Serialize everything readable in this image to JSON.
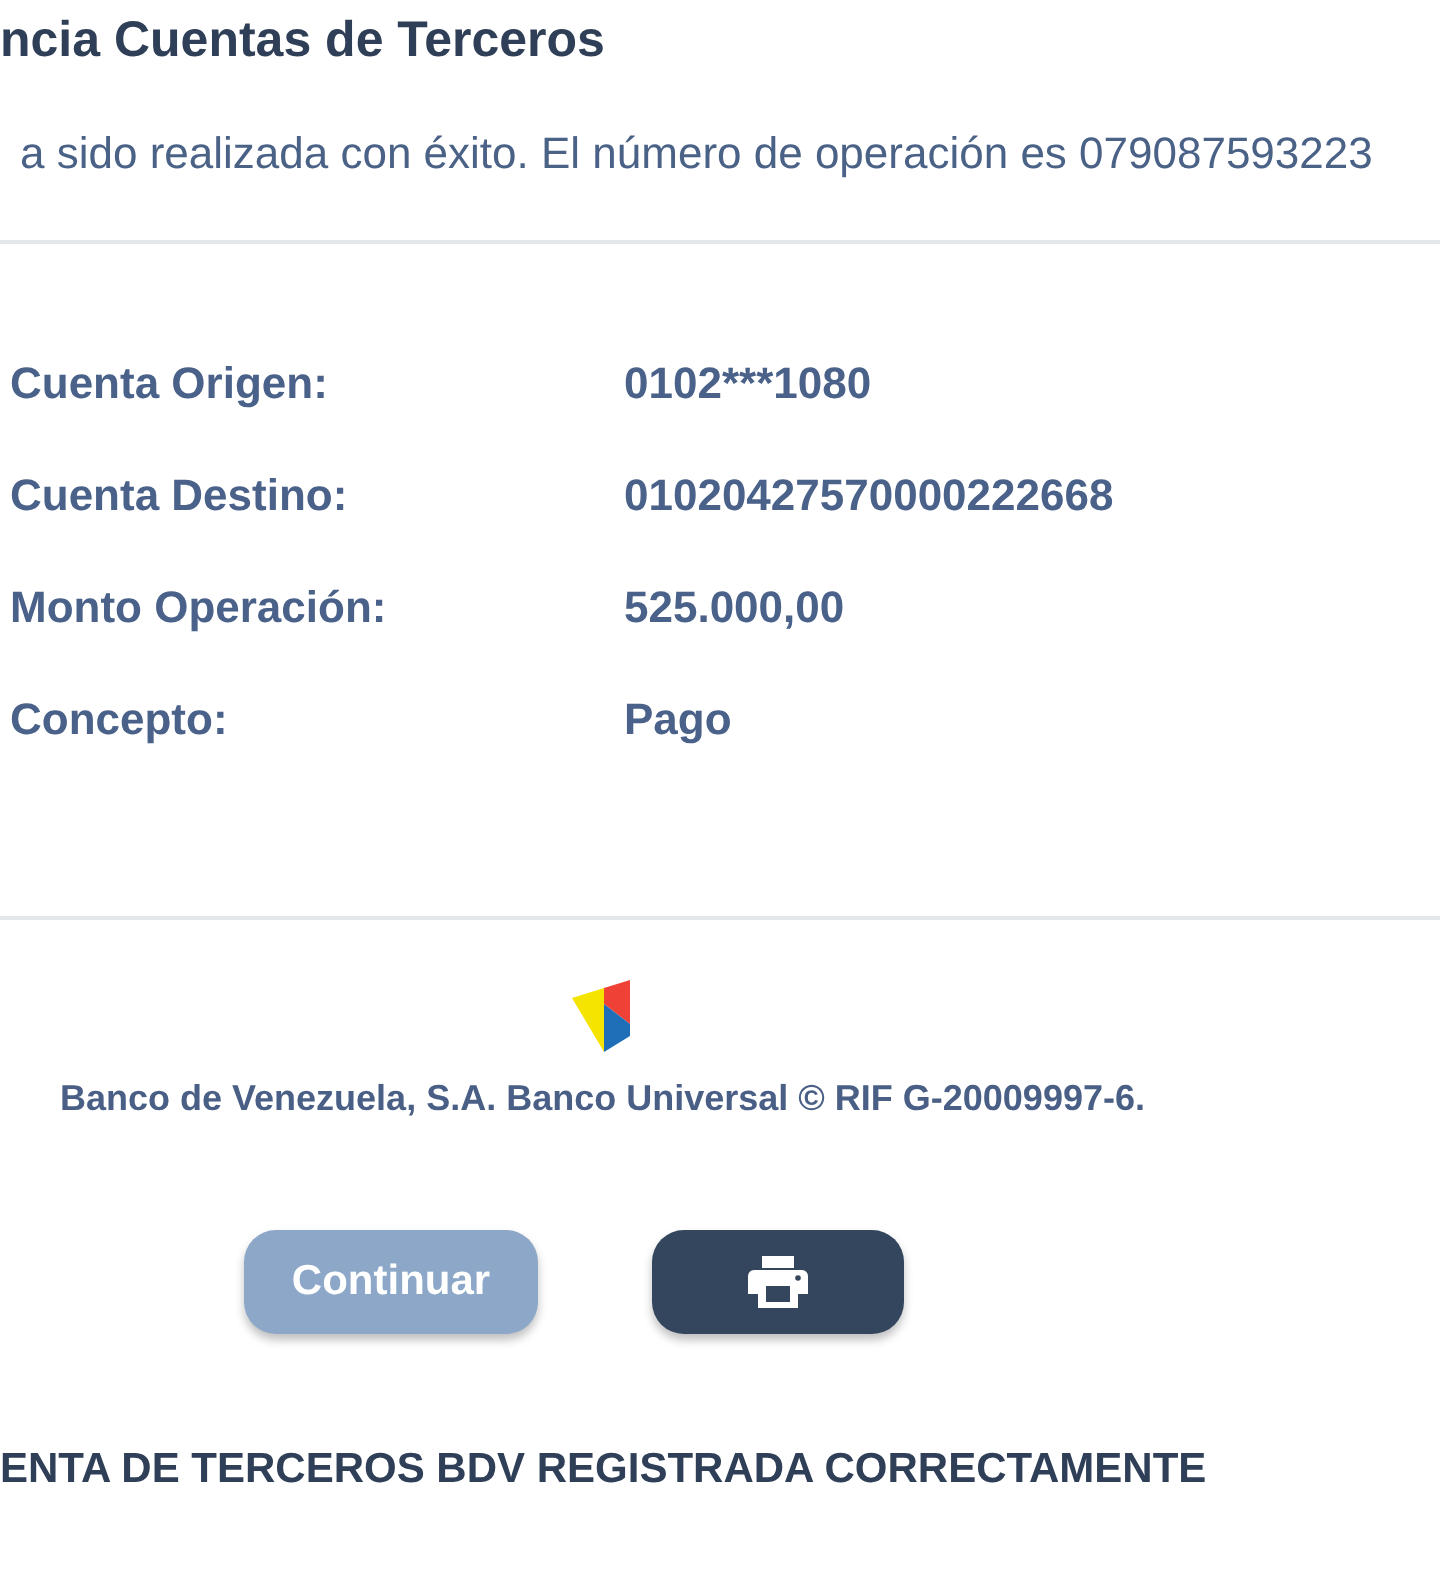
{
  "header": {
    "title": "ncia Cuentas de Terceros",
    "message": "a sido realizada con éxito. El número de operación es 079087593223"
  },
  "details": [
    {
      "label": "Cuenta Origen:",
      "value": "0102***1080"
    },
    {
      "label": "Cuenta Destino:",
      "value": "01020427570000222668"
    },
    {
      "label": "Monto Operación:",
      "value": "525.000,00"
    },
    {
      "label": "Concepto:",
      "value": "Pago"
    }
  ],
  "footer": {
    "text": "Banco de Venezuela, S.A. Banco Universal © RIF G-20009997-6."
  },
  "buttons": [
    {
      "kind": "text",
      "label": "Continuar",
      "disabled": true
    },
    {
      "kind": "print",
      "disabled": false
    }
  ],
  "notice": "ENTA DE TERCEROS BDV REGISTRADA CORRECTAMENTE"
}
